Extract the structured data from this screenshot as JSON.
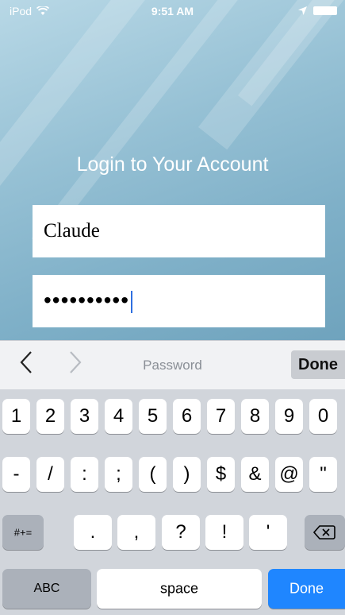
{
  "status_bar": {
    "carrier": "iPod",
    "time": "9:51 AM"
  },
  "login": {
    "title": "Login to Your Account",
    "username_value": "Claude",
    "password_mask": "••••••••••"
  },
  "accessory_bar": {
    "prev_icon": "chevron-left-icon",
    "next_icon": "chevron-right-icon",
    "field_name": "Password",
    "done_label": "Done"
  },
  "keyboard": {
    "row1": [
      "1",
      "2",
      "3",
      "4",
      "5",
      "6",
      "7",
      "8",
      "9",
      "0"
    ],
    "row2": [
      "-",
      "/",
      ":",
      ";",
      "(",
      ")",
      "$",
      "&",
      "@",
      "\""
    ],
    "row3": {
      "mode": "#+=",
      "keys": [
        ".",
        ",",
        "?",
        "!",
        "'"
      ],
      "backspace_icon": "backspace-icon"
    },
    "row4": {
      "abc": "ABC",
      "space": "space",
      "done": "Done"
    }
  },
  "colors": {
    "background_top": "#b8d8e6",
    "background_bottom": "#6fa3bd",
    "done_key": "#1f86ff",
    "caret": "#2f6fe0"
  }
}
